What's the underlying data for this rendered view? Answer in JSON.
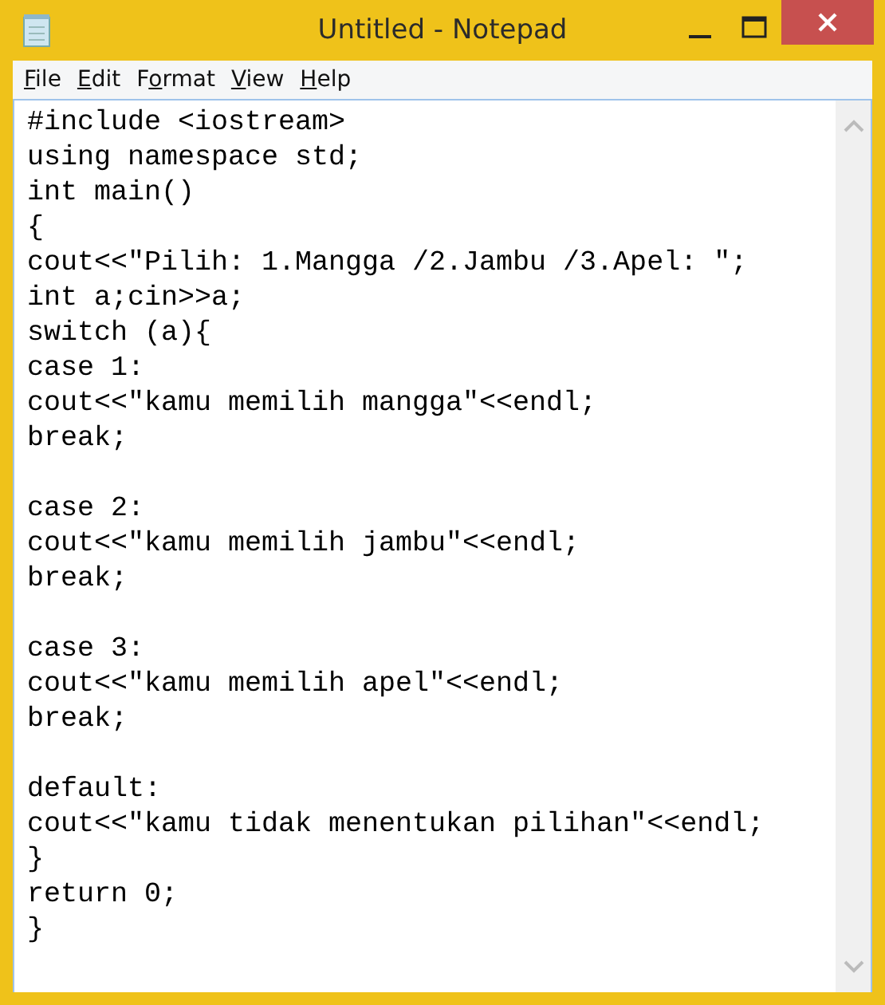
{
  "window": {
    "title": "Untitled - Notepad"
  },
  "menu": [
    {
      "access_key": "F",
      "after": "ile"
    },
    {
      "access_key": "E",
      "after": "dit"
    },
    {
      "before": "F",
      "access_key": "o",
      "after": "rmat"
    },
    {
      "access_key": "V",
      "after": "iew"
    },
    {
      "access_key": "H",
      "after": "elp"
    }
  ],
  "editor": {
    "text": "#include <iostream>\nusing namespace std;\nint main()\n{\ncout<<\"Pilih: 1.Mangga /2.Jambu /3.Apel: \";\nint a;cin>>a;\nswitch (a){\ncase 1:\ncout<<\"kamu memilih mangga\"<<endl;\nbreak;\n\ncase 2:\ncout<<\"kamu memilih jambu\"<<endl;\nbreak;\n\ncase 3:\ncout<<\"kamu memilih apel\"<<endl;\nbreak;\n\ndefault:\ncout<<\"kamu tidak menentukan pilihan\"<<endl;\n}\nreturn 0;\n}"
  }
}
